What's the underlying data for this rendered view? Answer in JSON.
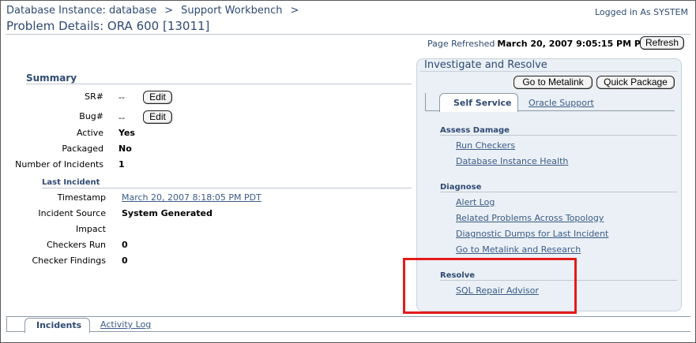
{
  "header": {
    "breadcrumb": [
      {
        "label": "Database Instance: database"
      },
      {
        "label": "Support Workbench"
      }
    ],
    "separator": ">",
    "logged_in": "Logged in As SYSTEM",
    "page_title": "Problem Details: ORA 600 [13011]"
  },
  "refresh": {
    "label": "Page Refreshed",
    "timestamp": "March 20, 2007 9:05:15 PM PDT",
    "button": "Refresh"
  },
  "summary": {
    "title": "Summary",
    "sr_label": "SR#",
    "sr_value": "--",
    "sr_edit": "Edit",
    "bug_label": "Bug#",
    "bug_value": "--",
    "bug_edit": "Edit",
    "active_label": "Active",
    "active_value": "Yes",
    "packaged_label": "Packaged",
    "packaged_value": "No",
    "incidents_label": "Number of Incidents",
    "incidents_value": "1"
  },
  "last_incident": {
    "title": "Last Incident",
    "timestamp_label": "Timestamp",
    "timestamp_value": "March 20, 2007 8:18:05 PM PDT",
    "source_label": "Incident Source",
    "source_value": "System Generated",
    "impact_label": "Impact",
    "impact_value": "",
    "checkers_label": "Checkers Run",
    "checkers_value": "0",
    "findings_label": "Checker Findings",
    "findings_value": "0"
  },
  "investigate": {
    "title": "Investigate and Resolve",
    "goto_metalink": "Go to Metalink",
    "quick_package": "Quick Package",
    "tabs": [
      {
        "label": "Self Service",
        "active": true
      },
      {
        "label": "Oracle Support",
        "active": false
      }
    ],
    "assess": {
      "title": "Assess Damage",
      "links": [
        "Run Checkers",
        "Database Instance Health"
      ]
    },
    "diagnose": {
      "title": "Diagnose",
      "links": [
        "Alert Log",
        "Related Problems Across Topology",
        "Diagnostic Dumps for Last Incident",
        "Go to Metalink and Research"
      ]
    },
    "resolve": {
      "title": "Resolve",
      "links": [
        "SQL Repair Advisor"
      ]
    }
  },
  "bottom_tabs": [
    {
      "label": "Incidents",
      "active": true
    },
    {
      "label": "Activity Log",
      "active": false
    }
  ],
  "colors": {
    "highlight": "#e31b1b",
    "link": "#3b5b88",
    "heading": "#2f4a73"
  }
}
